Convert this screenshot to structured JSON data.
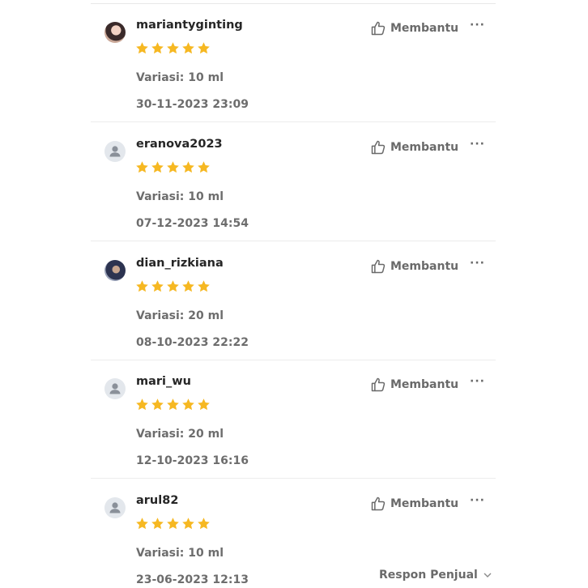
{
  "helpful_label": "Membantu",
  "more_label": "···",
  "star_color": "#f6b822",
  "reviews": [
    {
      "username": "mariantyginting",
      "rating": 5,
      "variation": "Variasi: 10 ml",
      "date": "30-11-2023 23:09",
      "avatar": "photo"
    },
    {
      "username": "eranova2023",
      "rating": 5,
      "variation": "Variasi: 10 ml",
      "date": "07-12-2023 14:54",
      "avatar": "default-user-icon"
    },
    {
      "username": "dian_rizkiana",
      "rating": 5,
      "variation": "Variasi: 20 ml",
      "date": "08-10-2023 22:22",
      "avatar": "photo"
    },
    {
      "username": "mari_wu",
      "rating": 5,
      "variation": "Variasi: 20 ml",
      "date": "12-10-2023 16:16",
      "avatar": "default-user-icon"
    },
    {
      "username": "arul82",
      "rating": 5,
      "variation": "Variasi: 10 ml",
      "date": "23-06-2023 12:13",
      "avatar": "default-user-icon"
    }
  ],
  "seller_response_label": "Respon Penjual"
}
